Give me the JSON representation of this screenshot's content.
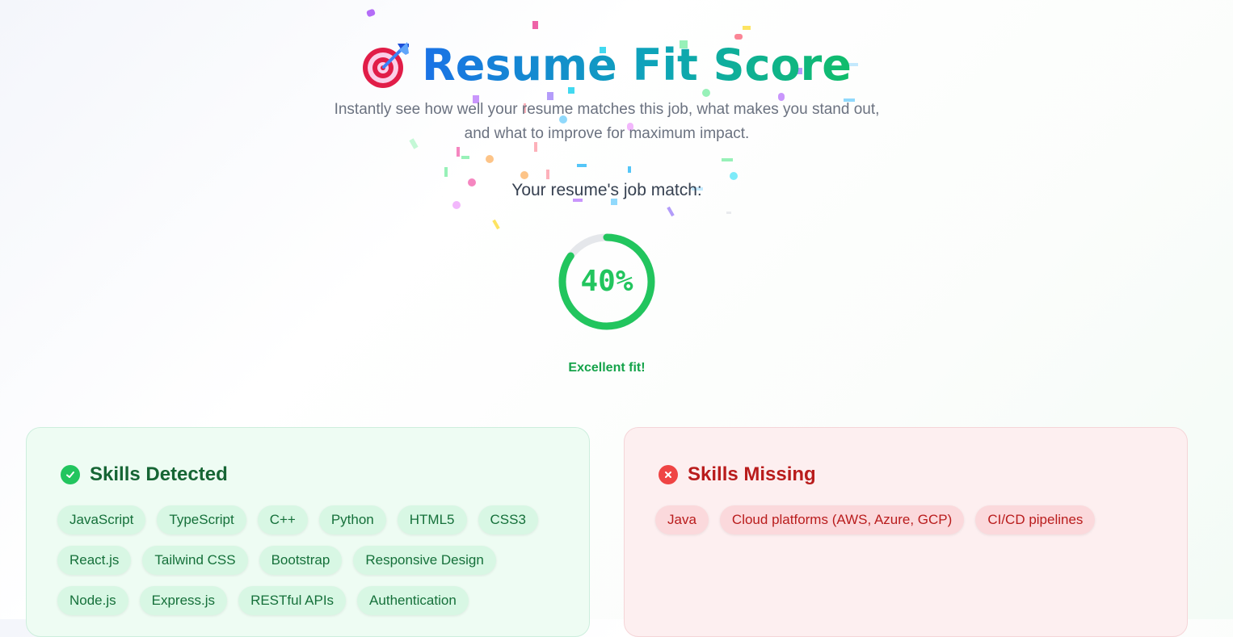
{
  "header": {
    "title": "Resume Fit Score",
    "title_icon": "target-dart-icon",
    "subtitle_line1": "Instantly see how well your resume matches this job, what makes you stand out,",
    "subtitle_line2": "and what to improve for maximum impact."
  },
  "score": {
    "label": "Your resume's job match:",
    "percent": 40,
    "percent_text": "40%",
    "verdict": "Excellent fit!",
    "ring_color": "#22c55e",
    "track_color": "#e5e7eb"
  },
  "skills_detected": {
    "title": "Skills Detected",
    "icon": "check-circle-icon",
    "items": [
      "JavaScript",
      "TypeScript",
      "C++",
      "Python",
      "HTML5",
      "CSS3",
      "React.js",
      "Tailwind CSS",
      "Bootstrap",
      "Responsive Design",
      "Node.js",
      "Express.js",
      "RESTful APIs",
      "Authentication"
    ]
  },
  "skills_missing": {
    "title": "Skills Missing",
    "icon": "x-circle-icon",
    "items": [
      "Java",
      "Cloud platforms (AWS, Azure, GCP)",
      "CI/CD pipelines"
    ]
  },
  "colors": {
    "detected_text": "#166534",
    "missing_text": "#b91c1c"
  }
}
